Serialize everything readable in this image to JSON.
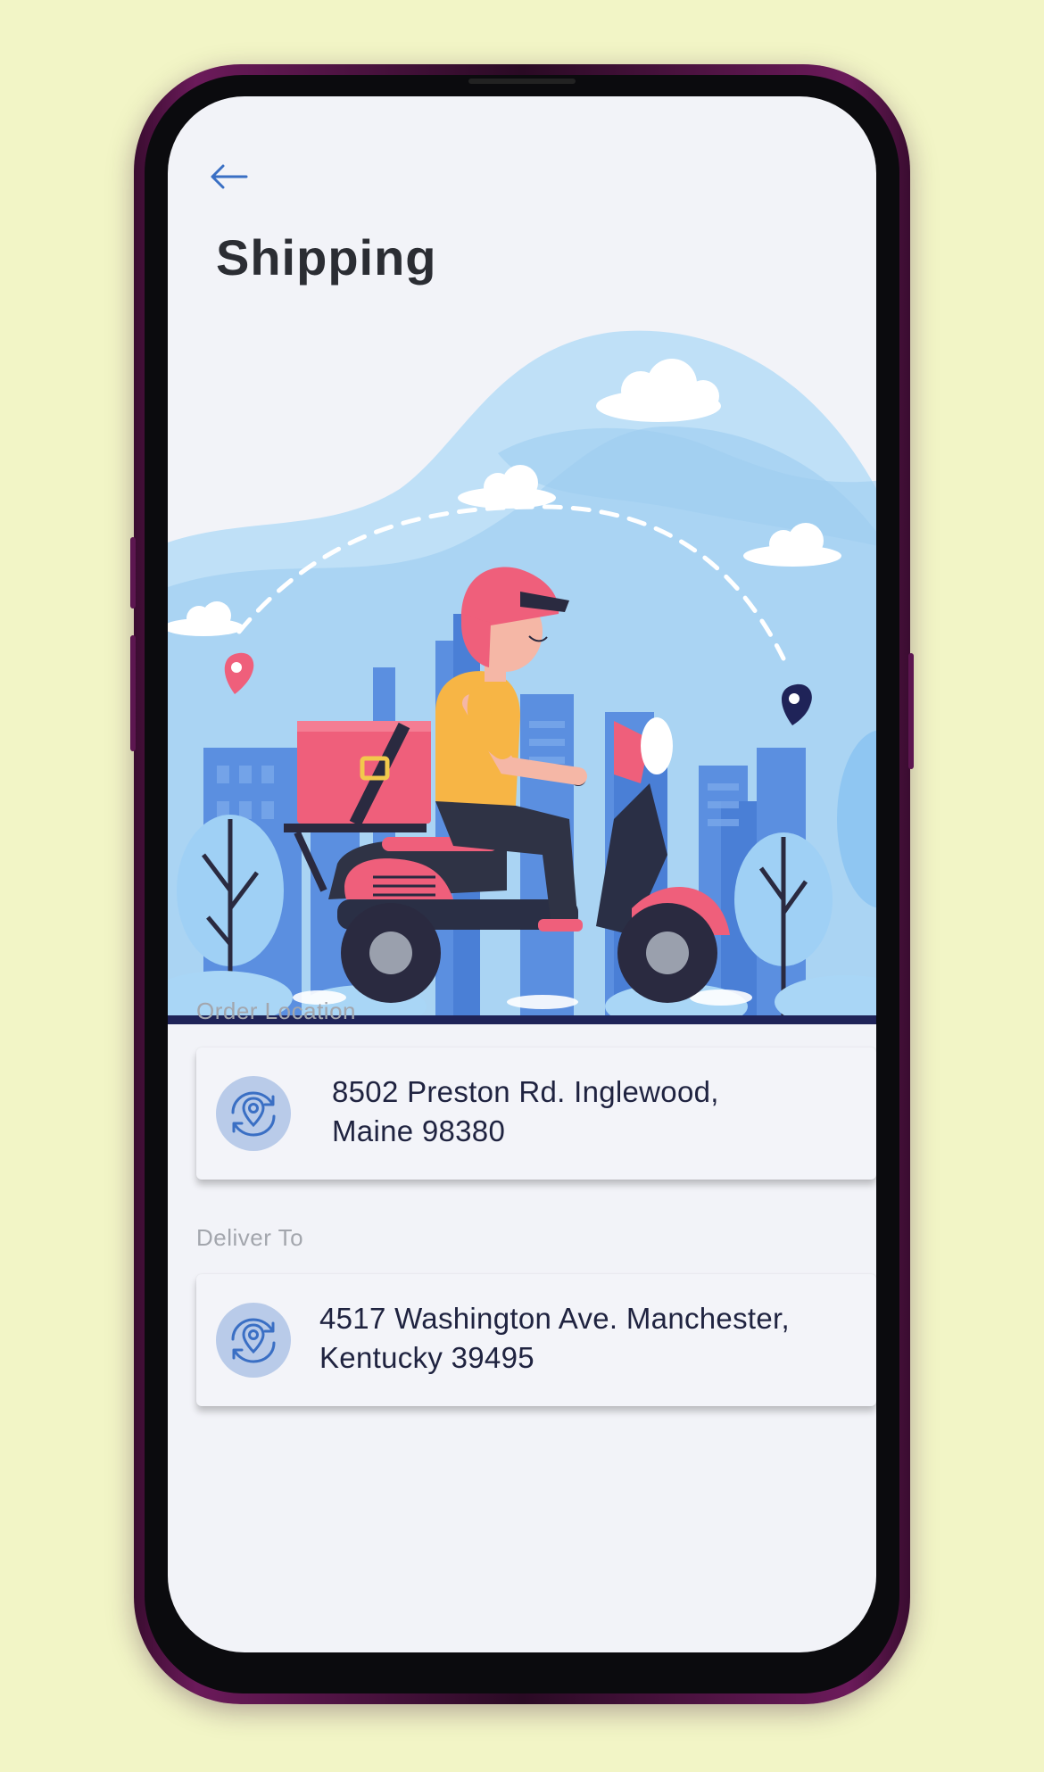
{
  "header": {
    "title": "Shipping"
  },
  "icons": {
    "back": "arrow-left-icon",
    "location": "location-sync-icon"
  },
  "order_location": {
    "label": "Order Location",
    "address": "8502 Preston Rd. Inglewood,\nMaine 98380"
  },
  "deliver_to": {
    "label": "Deliver To",
    "address": "4517 Washington Ave. Manchester,\nKentucky 39495"
  },
  "colors": {
    "background": "#f2f5c6",
    "screen": "#f2f3f8",
    "accent": "#3a6fc4",
    "title_text": "#2b2d33",
    "label_text": "#a3a6ad",
    "address_text": "#1f2340",
    "icon_bg": "#b9cbe9"
  }
}
